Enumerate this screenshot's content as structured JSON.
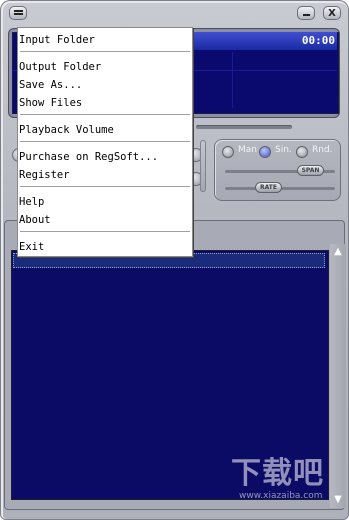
{
  "window": {
    "colors": {
      "frame": "#b5b8c1",
      "display": "#0a0a6e",
      "playlist": "#0b0b66",
      "accent": "#3f56c6"
    }
  },
  "titlebar": {
    "sysmenu_icon": "sysmenu-icon",
    "minimize_label": "_",
    "close_label": "X"
  },
  "display": {
    "time": "00:00"
  },
  "mode": {
    "options": [
      "Man",
      "Sin.",
      "Rnd."
    ],
    "selected": "Sin.",
    "span_label": "SPAN",
    "rate_label": "RATE"
  },
  "menu": {
    "items": [
      "Input Folder",
      "Output Folder",
      "Save As...",
      "Show Files",
      "Playback Volume",
      "Purchase on RegSoft...",
      "Register",
      "Help",
      "About",
      "Exit"
    ]
  },
  "watermark": {
    "logo": "下载吧",
    "url": "www.xiazaiba.com"
  }
}
